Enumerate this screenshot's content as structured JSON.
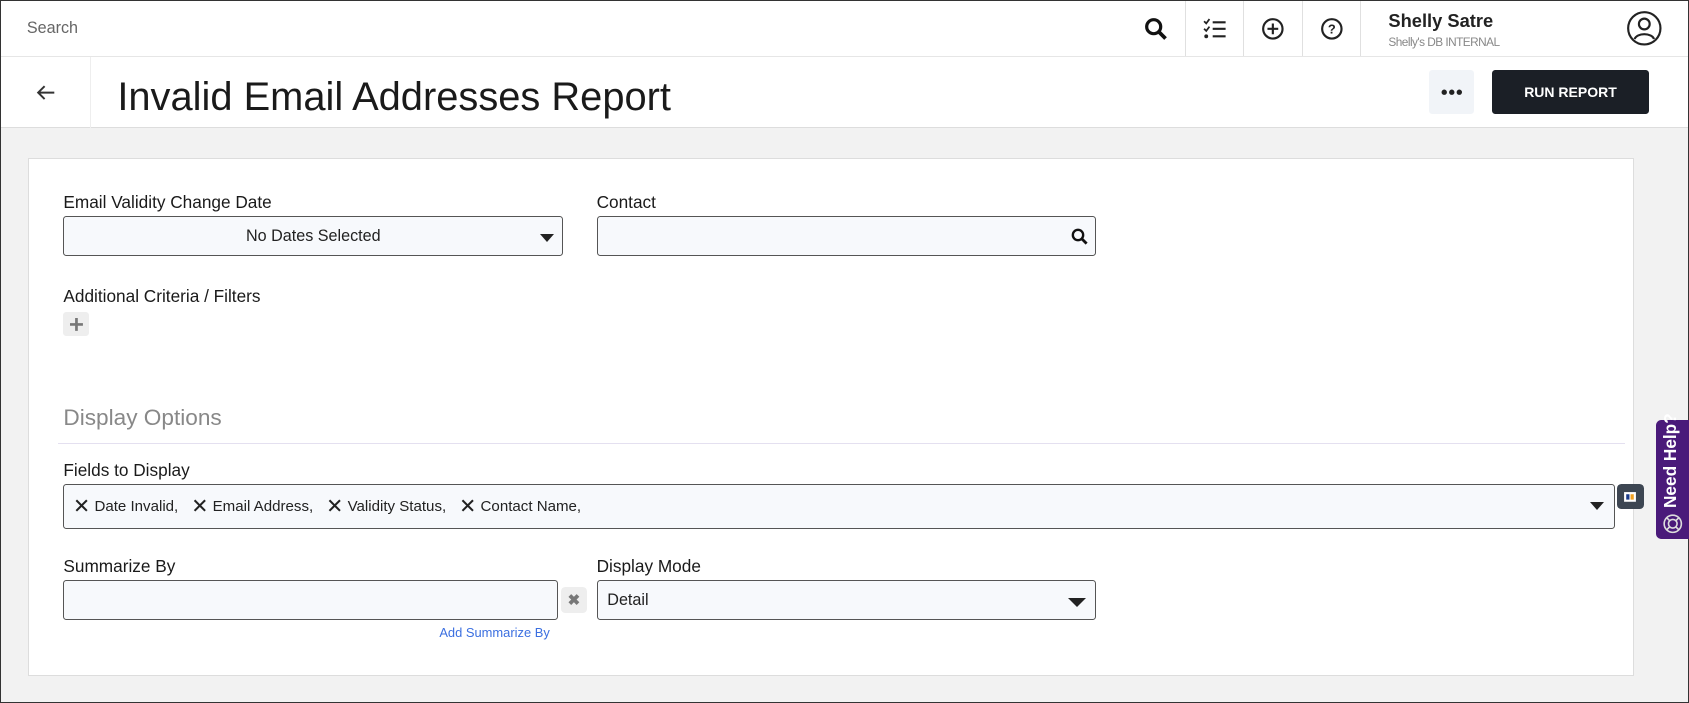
{
  "topbar": {
    "search_placeholder": "Search",
    "user_name": "Shelly Satre",
    "database": "Shelly's DB INTERNAL"
  },
  "header": {
    "title": "Invalid Email Addresses Report",
    "run_label": "RUN REPORT"
  },
  "form": {
    "date_label": "Email Validity Change Date",
    "date_value": "No Dates Selected",
    "contact_label": "Contact",
    "contact_value": "",
    "criteria_label": "Additional Criteria / Filters",
    "display_options": "Display Options",
    "fields_label": "Fields to Display",
    "fields": [
      "Date Invalid,",
      "Email Address,",
      "Validity Status,",
      "Contact Name,"
    ],
    "summarize_label": "Summarize By",
    "summarize_value": "",
    "add_summarize": "Add Summarize By",
    "mode_label": "Display Mode",
    "mode_value": "Detail"
  },
  "help": {
    "label": "Need Help?"
  },
  "colors": {
    "run_button": "#1b1f26",
    "help_tab": "#4a1a7a",
    "link": "#3b6fe0"
  }
}
